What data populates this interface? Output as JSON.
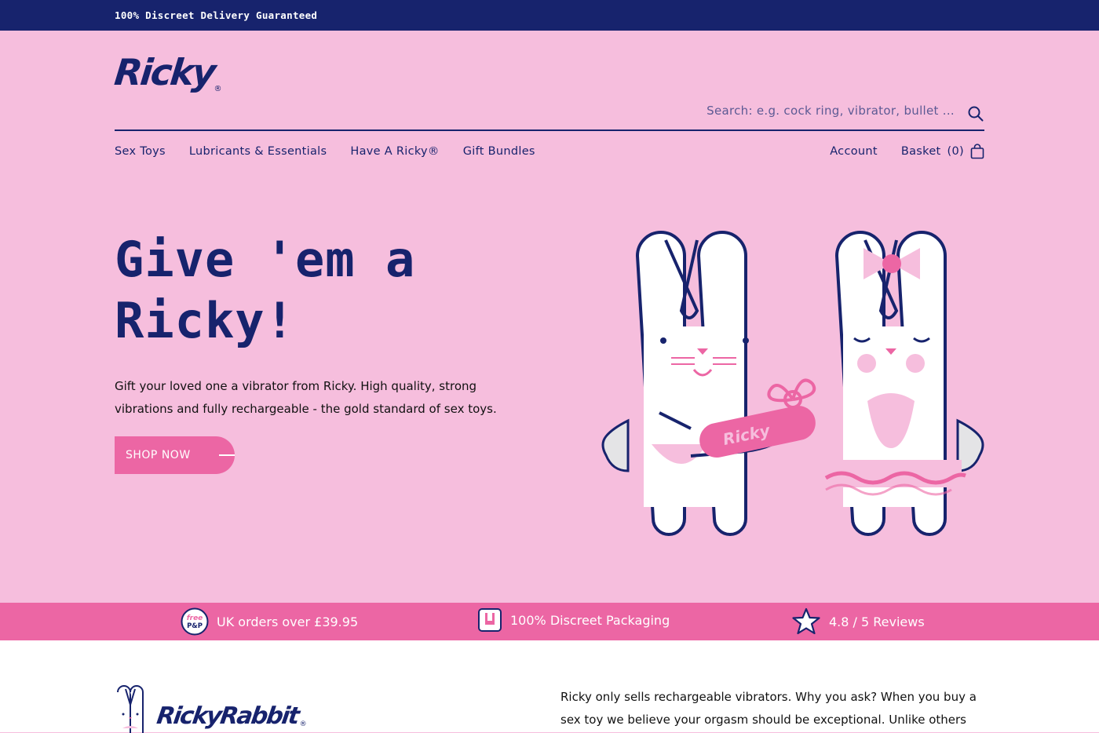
{
  "announcement": {
    "text": "100% Discreet Delivery Guaranteed"
  },
  "header": {
    "logo_text": "Ricky",
    "logo_mark": "®",
    "search_placeholder": "Search: e.g. cock ring, vibrator, bullet ...",
    "nav": [
      "Sex Toys",
      "Lubricants & Essentials",
      "Have A Ricky®",
      "Gift Bundles"
    ],
    "account_label": "Account",
    "basket_label": "Basket",
    "basket_count": "(0)"
  },
  "hero": {
    "title_line1": "Give 'em a",
    "title_line2": "Ricky!",
    "subtitle": "Gift your loved one a vibrator from Ricky. High quality, strong vibrations and fully rechargeable - the gold standard of sex toys.",
    "cta": "SHOP NOW",
    "gift_label": "Ricky"
  },
  "usp": [
    {
      "icon": "free-pp-icon",
      "badge_top": "free",
      "badge_bottom": "P&P",
      "text": "UK orders over £39.95"
    },
    {
      "icon": "package-icon",
      "text": "100% Discreet Packaging"
    },
    {
      "icon": "star-icon",
      "text": "4.8 / 5 Reviews"
    }
  ],
  "bottom": {
    "brand": "RickyRabbit",
    "brand_mark": "®",
    "intro": "Ricky only sells rechargeable vibrators. Why you ask? When you buy a sex toy we believe your orgasm should be exceptional. Unlike others"
  },
  "colors": {
    "navy": "#17236d",
    "pink_bg": "#f6bedd",
    "hot_pink": "#ec66a4"
  }
}
